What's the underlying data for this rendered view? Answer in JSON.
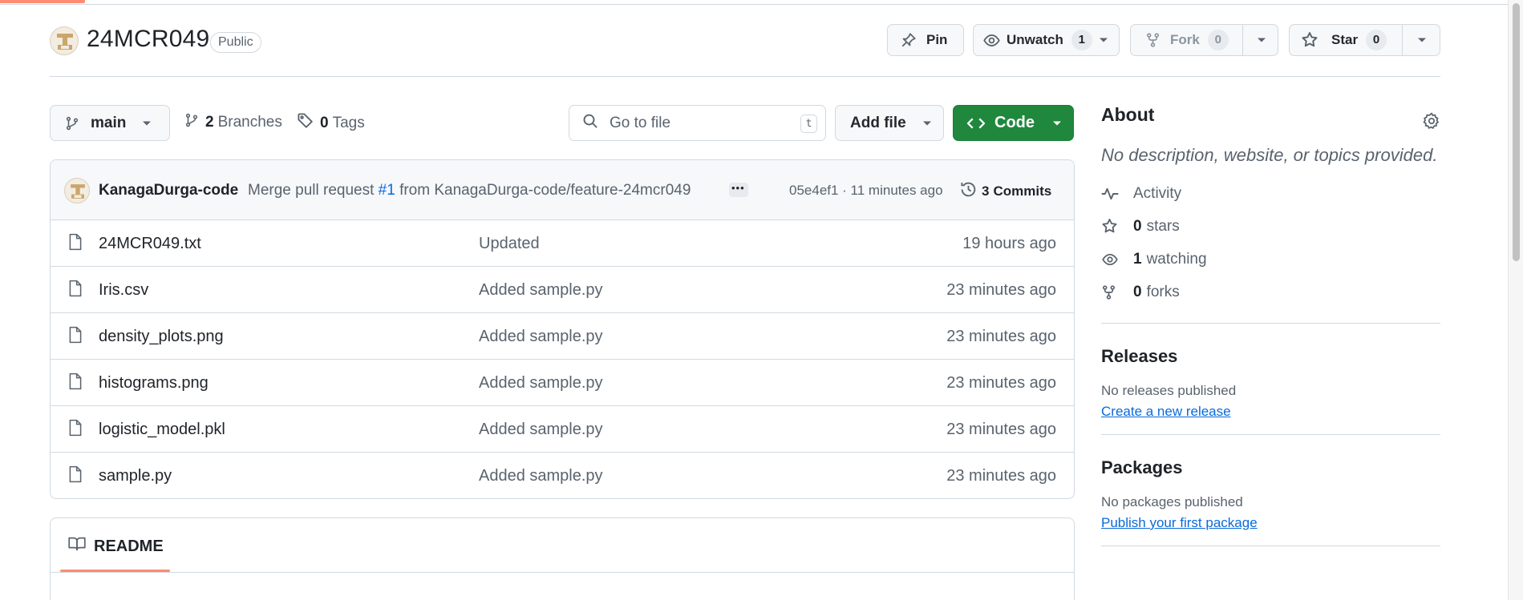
{
  "repo": {
    "name": "24MCR049",
    "visibility": "Public"
  },
  "actions": {
    "pin_label": "Pin",
    "unwatch_label": "Unwatch",
    "unwatch_count": "1",
    "fork_label": "Fork",
    "fork_count": "0",
    "star_label": "Star",
    "star_count": "0"
  },
  "toolbar": {
    "branch": "main",
    "branches_count": "2",
    "branches_label": "Branches",
    "tags_count": "0",
    "tags_label": "Tags",
    "search_placeholder": "Go to file",
    "search_shortcut": "t",
    "add_file_label": "Add file",
    "code_label": "Code"
  },
  "latest_commit": {
    "author": "KanagaDurga-code",
    "message_prefix": "Merge pull request",
    "pr_number": "#1",
    "message_suffix": "from KanagaDurga-code/feature-24mcr049",
    "meta": "05e4ef1 · 11 minutes ago",
    "commits_count": "3",
    "commits_label": "Commits"
  },
  "files": [
    {
      "name": "24MCR049.txt",
      "message": "Updated",
      "time": "19 hours ago"
    },
    {
      "name": "Iris.csv",
      "message": "Added sample.py",
      "time": "23 minutes ago"
    },
    {
      "name": "density_plots.png",
      "message": "Added sample.py",
      "time": "23 minutes ago"
    },
    {
      "name": "histograms.png",
      "message": "Added sample.py",
      "time": "23 minutes ago"
    },
    {
      "name": "logistic_model.pkl",
      "message": "Added sample.py",
      "time": "23 minutes ago"
    },
    {
      "name": "sample.py",
      "message": "Added sample.py",
      "time": "23 minutes ago"
    }
  ],
  "readme": {
    "tab_label": "README"
  },
  "about": {
    "title": "About",
    "description": "No description, website, or topics provided.",
    "activity_label": "Activity",
    "stars_count": "0",
    "stars_label": "stars",
    "watching_count": "1",
    "watching_label": "watching",
    "forks_count": "0",
    "forks_label": "forks"
  },
  "releases": {
    "title": "Releases",
    "empty_text": "No releases published",
    "link": "Create a new release"
  },
  "packages": {
    "title": "Packages",
    "empty_text": "No packages published",
    "link": "Publish your first package"
  },
  "colors": {
    "accent_green": "#1f883d",
    "link_blue": "#0969da",
    "underline_orange": "#fd8c73",
    "muted_text": "#59636e",
    "border": "#d1d9e0"
  }
}
